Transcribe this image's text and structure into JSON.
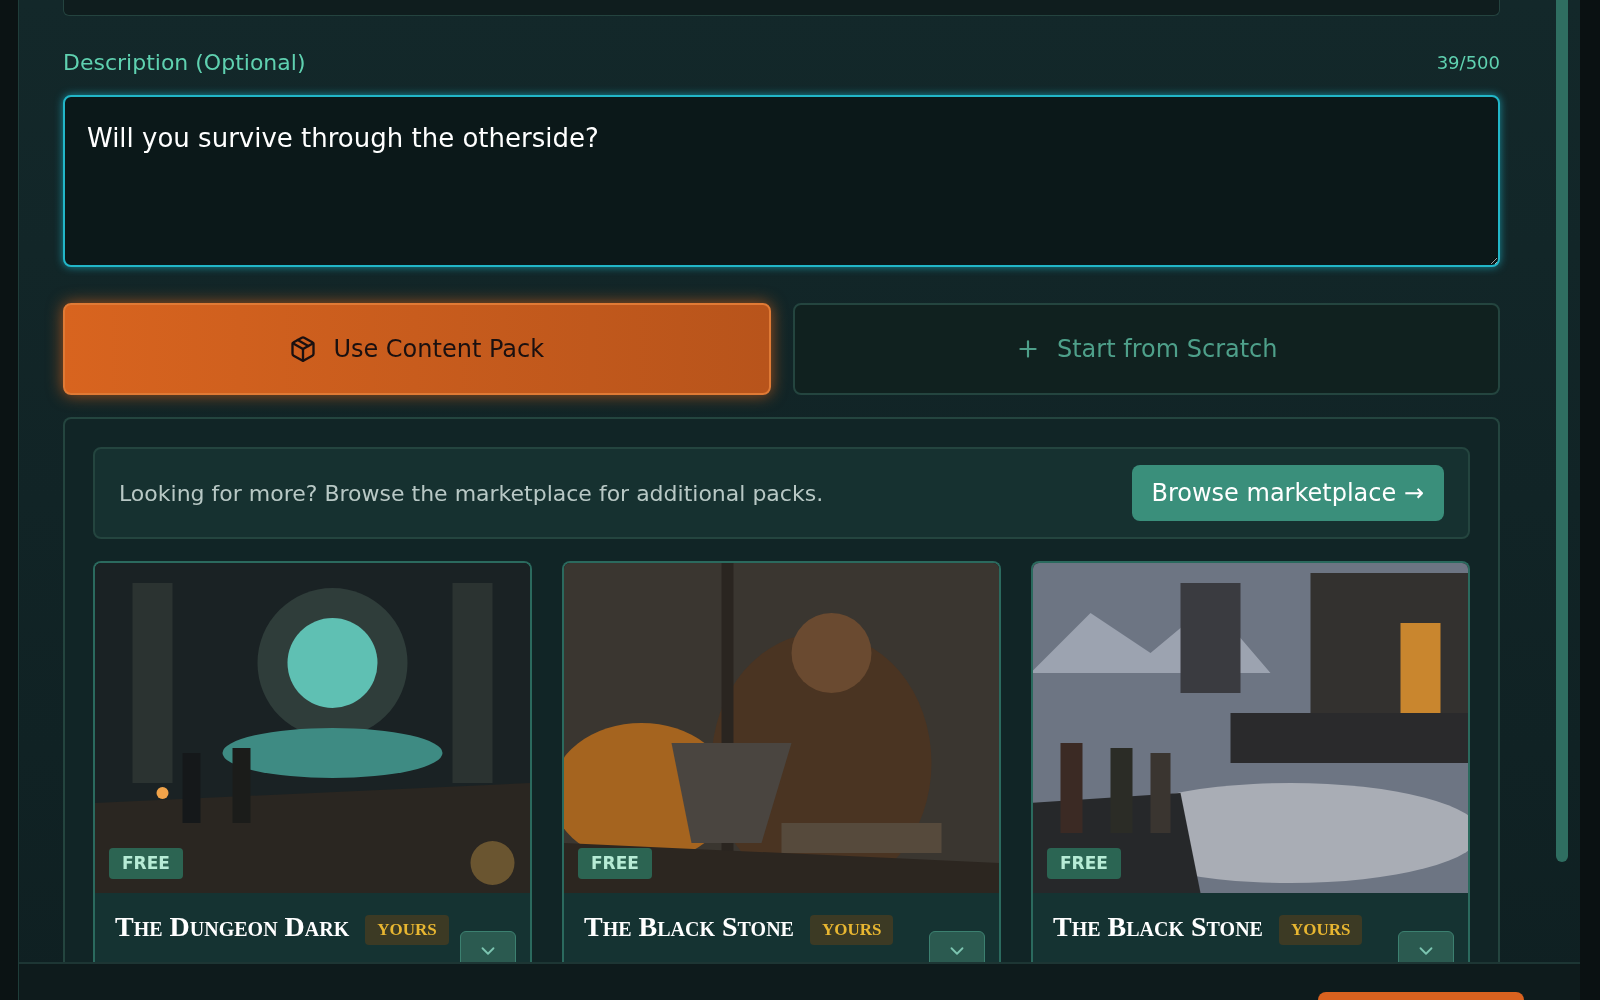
{
  "description": {
    "label": "Description (Optional)",
    "counter": "39/500",
    "value": "Will you survive through the otherside?"
  },
  "modes": [
    {
      "label": "Use Content Pack",
      "kind": "pack",
      "selected": true
    },
    {
      "label": "Start from Scratch",
      "kind": "scratch",
      "selected": false
    }
  ],
  "marketplace": {
    "text": "Looking for more? Browse the marketplace for additional packs.",
    "button": "Browse marketplace →"
  },
  "packs": [
    {
      "title": "The Dungeon Dark",
      "price": "FREE",
      "owned": "YOURS"
    },
    {
      "title": "The Black Stone",
      "price": "FREE",
      "owned": "YOURS"
    },
    {
      "title": "The Black Stone",
      "price": "FREE",
      "owned": "YOURS"
    }
  ]
}
